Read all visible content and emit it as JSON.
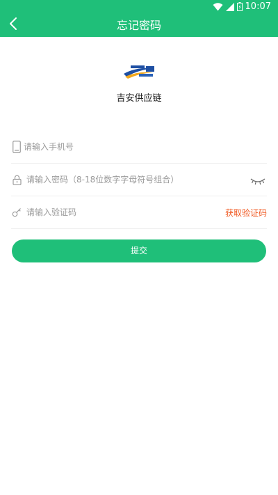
{
  "status_bar": {
    "time": "10:07",
    "icons": [
      "wifi-icon",
      "signal-icon",
      "battery-icon"
    ]
  },
  "app_bar": {
    "title": "忘记密码",
    "back_icon": "chevron-left-icon"
  },
  "brand": {
    "name": "吉安供应链",
    "logo_icon": "company-logo"
  },
  "form": {
    "phone": {
      "placeholder": "请输入手机号",
      "value": "",
      "icon": "phone-icon"
    },
    "password": {
      "placeholder": "请输入密码（8-18位数字字母符号组合）",
      "value": "",
      "icon": "lock-icon",
      "toggle_icon": "eye-closed-icon"
    },
    "code": {
      "placeholder": "请输入验证码",
      "value": "",
      "icon": "key-icon",
      "get_code_label": "获取验证码"
    },
    "submit_label": "提交"
  },
  "colors": {
    "primary": "#1fbf79",
    "accent": "#f05a23",
    "placeholder": "#9a9a9a",
    "divider": "#eeeeee"
  }
}
